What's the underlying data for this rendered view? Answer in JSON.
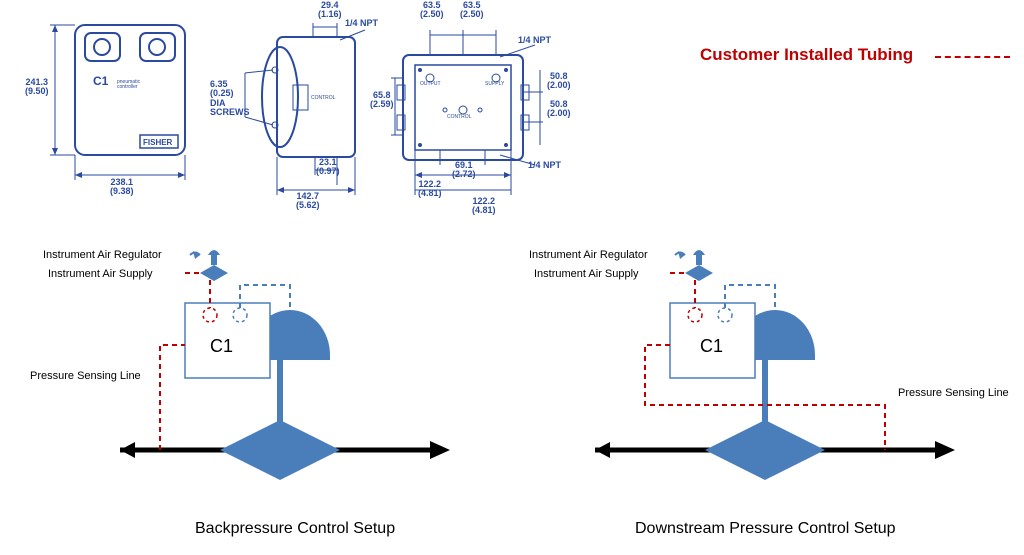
{
  "legend": {
    "label": "Customer Installed Tubing"
  },
  "drawings": {
    "front": {
      "height": {
        "mm": "241.3",
        "in": "(9.50)"
      },
      "width": {
        "mm": "238.1",
        "in": "(9.38)"
      }
    },
    "side": {
      "top": {
        "mm": "29.4",
        "in": "(1.16)"
      },
      "screws": {
        "mm": "6.35",
        "in": "(0.25)",
        "label": "DIA\nSCREWS"
      },
      "depth": {
        "mm": "23.1",
        "in": "(0.97)"
      },
      "total_depth": {
        "mm": "142.7",
        "in": "(5.62)"
      },
      "port_top": "1/4 NPT"
    },
    "back": {
      "port_top": "1/4 NPT",
      "port_bottom": "1/4 NPT",
      "col_left": {
        "mm": "63.5",
        "in": "(2.50)"
      },
      "col_right": {
        "mm": "63.5",
        "in": "(2.50)"
      },
      "height": {
        "mm": "65.8",
        "in": "(2.59)"
      },
      "row_top": {
        "mm": "50.8",
        "in": "(2.00)"
      },
      "row_bot": {
        "mm": "50.8",
        "in": "(2.00)"
      },
      "center": {
        "mm": "69.1",
        "in": "(2.72)"
      },
      "width": {
        "mm": "122.2",
        "in": "(4.81)"
      },
      "width2": {
        "mm": "122.2",
        "in": "(4.81)"
      }
    }
  },
  "schematic": {
    "regulator_label": "Instrument Air Regulator",
    "supply_label": "Instrument Air Supply",
    "sensing_label": "Pressure Sensing Line",
    "controller": "C1"
  },
  "left_setup": {
    "title": "Backpressure Control Setup"
  },
  "right_setup": {
    "title": "Downstream Pressure Control Setup"
  }
}
